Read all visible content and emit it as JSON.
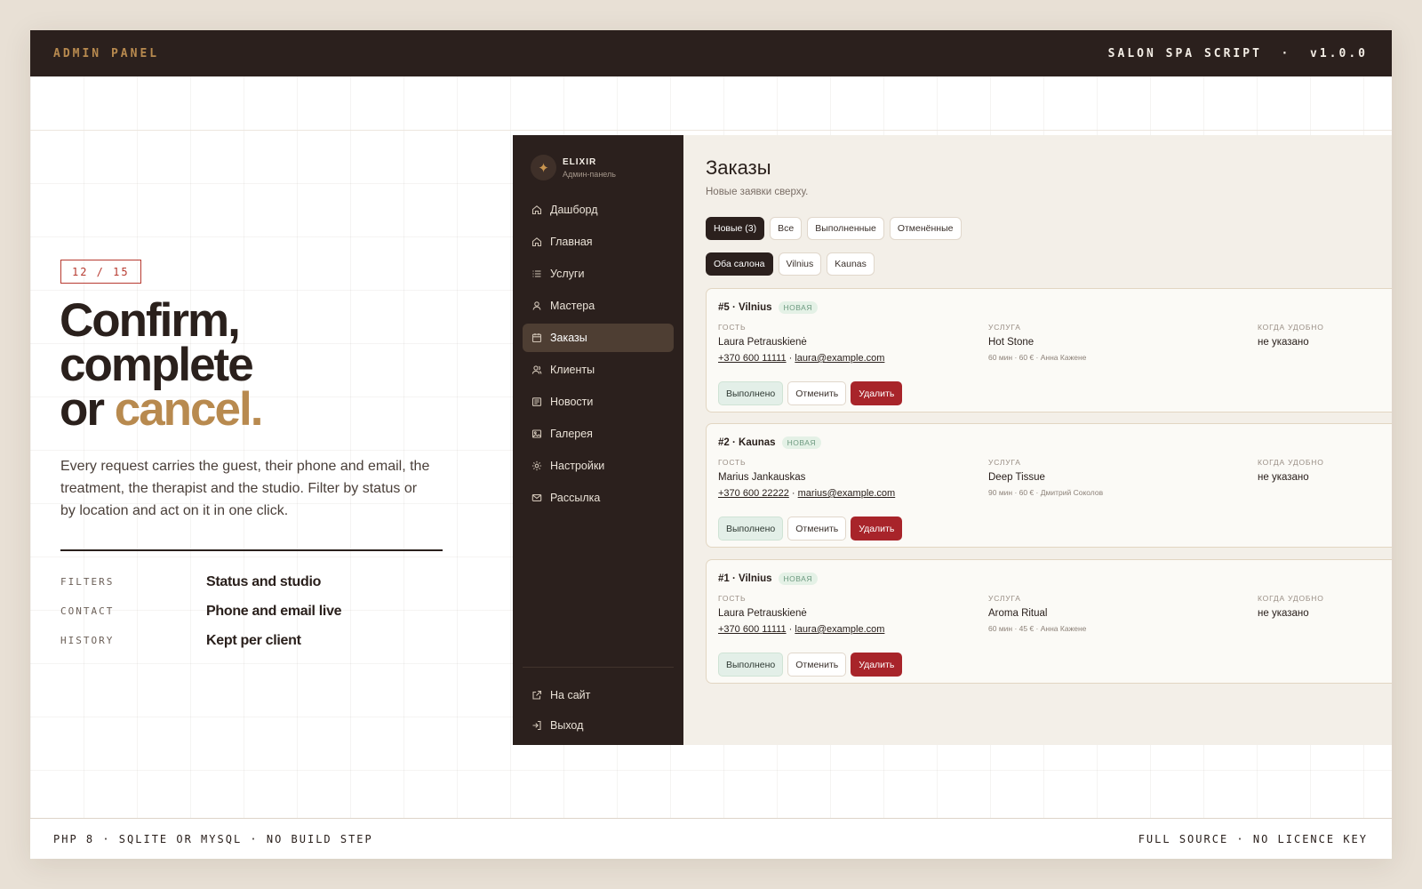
{
  "topbar": {
    "left": "ADMIN PANEL",
    "right": "SALON SPA SCRIPT  ·  v1.0.0"
  },
  "slide": {
    "counter": "12 / 15",
    "headline": {
      "line1": "Confirm,",
      "line2": "complete",
      "line3_plain": "or ",
      "line3_accent": "cancel."
    },
    "lede": "Every request carries the guest, their phone and email, the treatment, the therapist and the studio. Filter by status or by location and act on it in one click.",
    "facts": [
      {
        "key": "FILTERS",
        "value": "Status and studio"
      },
      {
        "key": "CONTACT",
        "value": "Phone and email live"
      },
      {
        "key": "HISTORY",
        "value": "Kept per client"
      }
    ]
  },
  "footer": {
    "left": "PHP 8 · SQLITE OR MYSQL · NO BUILD STEP",
    "right": "FULL SOURCE · NO LICENCE KEY"
  },
  "app": {
    "brand": {
      "name": "ELIXIR",
      "sub": "Админ-панель"
    },
    "nav": [
      {
        "label": "Дашборд",
        "icon": "home-icon"
      },
      {
        "label": "Главная",
        "icon": "home-icon"
      },
      {
        "label": "Услуги",
        "icon": "list-icon"
      },
      {
        "label": "Мастера",
        "icon": "user-icon"
      },
      {
        "label": "Заказы",
        "icon": "calendar-icon",
        "active": true
      },
      {
        "label": "Клиенты",
        "icon": "users-icon"
      },
      {
        "label": "Новости",
        "icon": "newspaper-icon"
      },
      {
        "label": "Галерея",
        "icon": "image-icon"
      },
      {
        "label": "Настройки",
        "icon": "gear-icon"
      },
      {
        "label": "Рассылка",
        "icon": "mail-icon"
      }
    ],
    "nav_bottom": [
      {
        "label": "На сайт",
        "icon": "external-link-icon"
      },
      {
        "label": "Выход",
        "icon": "logout-icon"
      }
    ],
    "page": {
      "title": "Заказы",
      "subtitle": "Новые заявки сверху.",
      "status_filters": [
        {
          "label": "Новые (3)",
          "active": true
        },
        {
          "label": "Все"
        },
        {
          "label": "Выполненные"
        },
        {
          "label": "Отменённые"
        }
      ],
      "location_filters": [
        {
          "label": "Оба салона",
          "active": true
        },
        {
          "label": "Vilnius"
        },
        {
          "label": "Kaunas"
        }
      ],
      "labels": {
        "guest": "ГОСТЬ",
        "service": "УСЛУГА",
        "when": "КОГДА УДОБНО"
      },
      "actions": {
        "done": "Выполнено",
        "cancel": "Отменить",
        "delete": "Удалить"
      },
      "orders": [
        {
          "id": "#5 · Vilnius",
          "badge": "НОВАЯ",
          "guest": "Laura Petrauskienė",
          "phone": "+370 600 11111",
          "email": "laura@example.com",
          "service": "Hot Stone",
          "meta": "60 мин · 60 € · Анна Кажене",
          "when": "не указано"
        },
        {
          "id": "#2 · Kaunas",
          "badge": "НОВАЯ",
          "guest": "Marius Jankauskas",
          "phone": "+370 600 22222",
          "email": "marius@example.com",
          "service": "Deep Tissue",
          "meta": "90 мин · 60 € · Дмитрий Соколов",
          "when": "не указано"
        },
        {
          "id": "#1 · Vilnius",
          "badge": "НОВАЯ",
          "guest": "Laura Petrauskienė",
          "phone": "+370 600 11111",
          "email": "laura@example.com",
          "service": "Aroma Ritual",
          "meta": "60 мин · 45 € · Анна Кажене",
          "when": "не указано"
        }
      ]
    }
  },
  "colors": {
    "dark": "#2b201d",
    "accent": "#b88a4f",
    "danger": "#a8242a",
    "counter": "#b73a30"
  }
}
